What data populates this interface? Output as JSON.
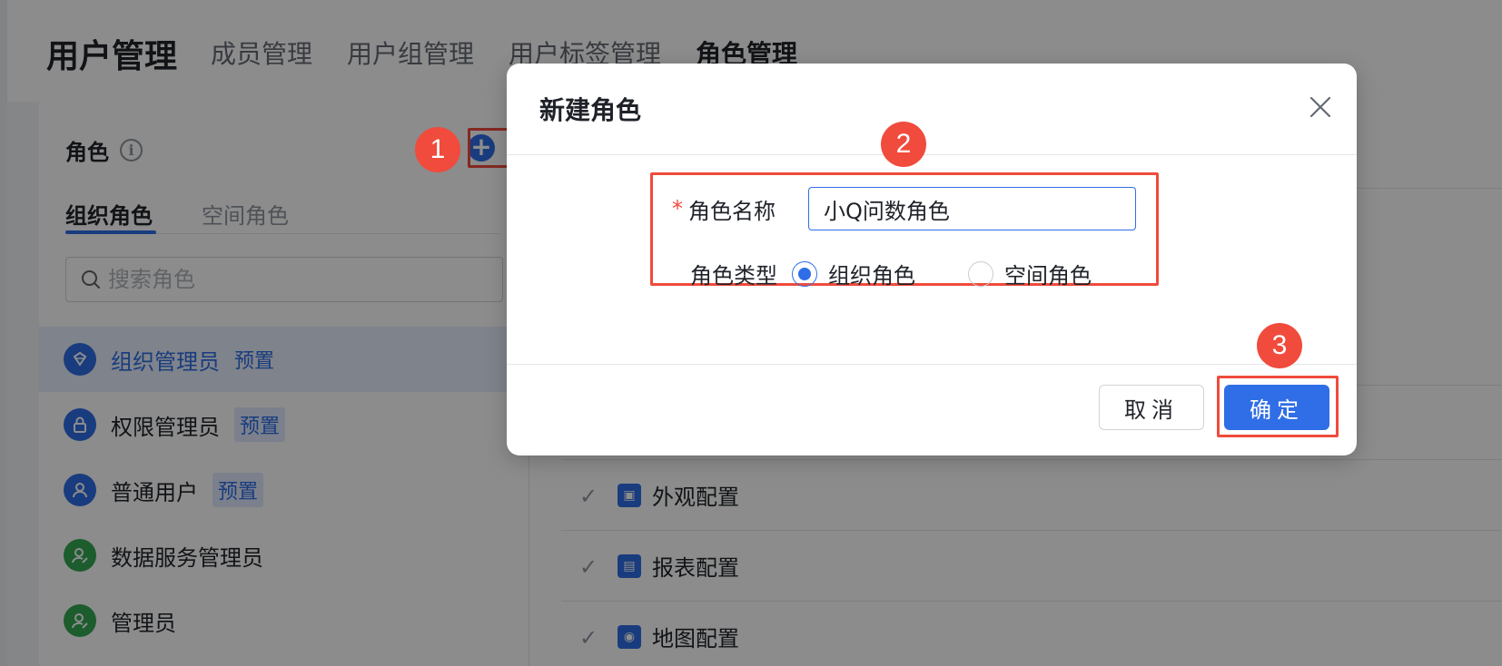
{
  "header": {
    "title": "用户管理",
    "tabs": [
      {
        "label": "成员管理",
        "active": false
      },
      {
        "label": "用户组管理",
        "active": false
      },
      {
        "label": "用户标签管理",
        "active": false
      },
      {
        "label": "角色管理",
        "active": true
      }
    ]
  },
  "sidebar": {
    "heading": "角色",
    "info_icon": "info-icon",
    "add_icon": "plus-circle-icon",
    "tabs": [
      {
        "label": "组织角色",
        "active": true
      },
      {
        "label": "空间角色",
        "active": false
      }
    ],
    "search": {
      "placeholder": "搜索角色",
      "value": ""
    },
    "roles": [
      {
        "name": "组织管理员",
        "tag": "预置",
        "icon": "shield-gem-icon",
        "color": "blue",
        "selected": true
      },
      {
        "name": "权限管理员",
        "tag": "预置",
        "icon": "lock-icon",
        "color": "blue",
        "selected": false
      },
      {
        "name": "普通用户",
        "tag": "预置",
        "icon": "user-icon",
        "color": "blue",
        "selected": false
      },
      {
        "name": "数据服务管理员",
        "tag": "",
        "icon": "user-edit-icon",
        "color": "green",
        "selected": false
      },
      {
        "name": "管理员",
        "tag": "",
        "icon": "user-edit-icon",
        "color": "green",
        "selected": false
      }
    ]
  },
  "permissions": [
    {
      "label": "外观配置",
      "icon": "shirt-icon",
      "checked": true
    },
    {
      "label": "报表配置",
      "icon": "report-icon",
      "checked": true
    },
    {
      "label": "地图配置",
      "icon": "map-pin-icon",
      "checked": true
    }
  ],
  "modal": {
    "title": "新建角色",
    "close_icon": "close-icon",
    "name_label": "角色名称",
    "name_required": "*",
    "name_value": "小Q问数角色",
    "type_label": "角色类型",
    "type_options": [
      {
        "label": "组织角色",
        "checked": true
      },
      {
        "label": "空间角色",
        "checked": false
      }
    ],
    "cancel_label": "取消",
    "confirm_label": "确定"
  },
  "annotations": {
    "step1": "1",
    "step2": "2",
    "step3": "3",
    "highlight_color": "#f04b3c"
  },
  "colors": {
    "accent": "#2f6ee6",
    "success": "#34a853"
  }
}
